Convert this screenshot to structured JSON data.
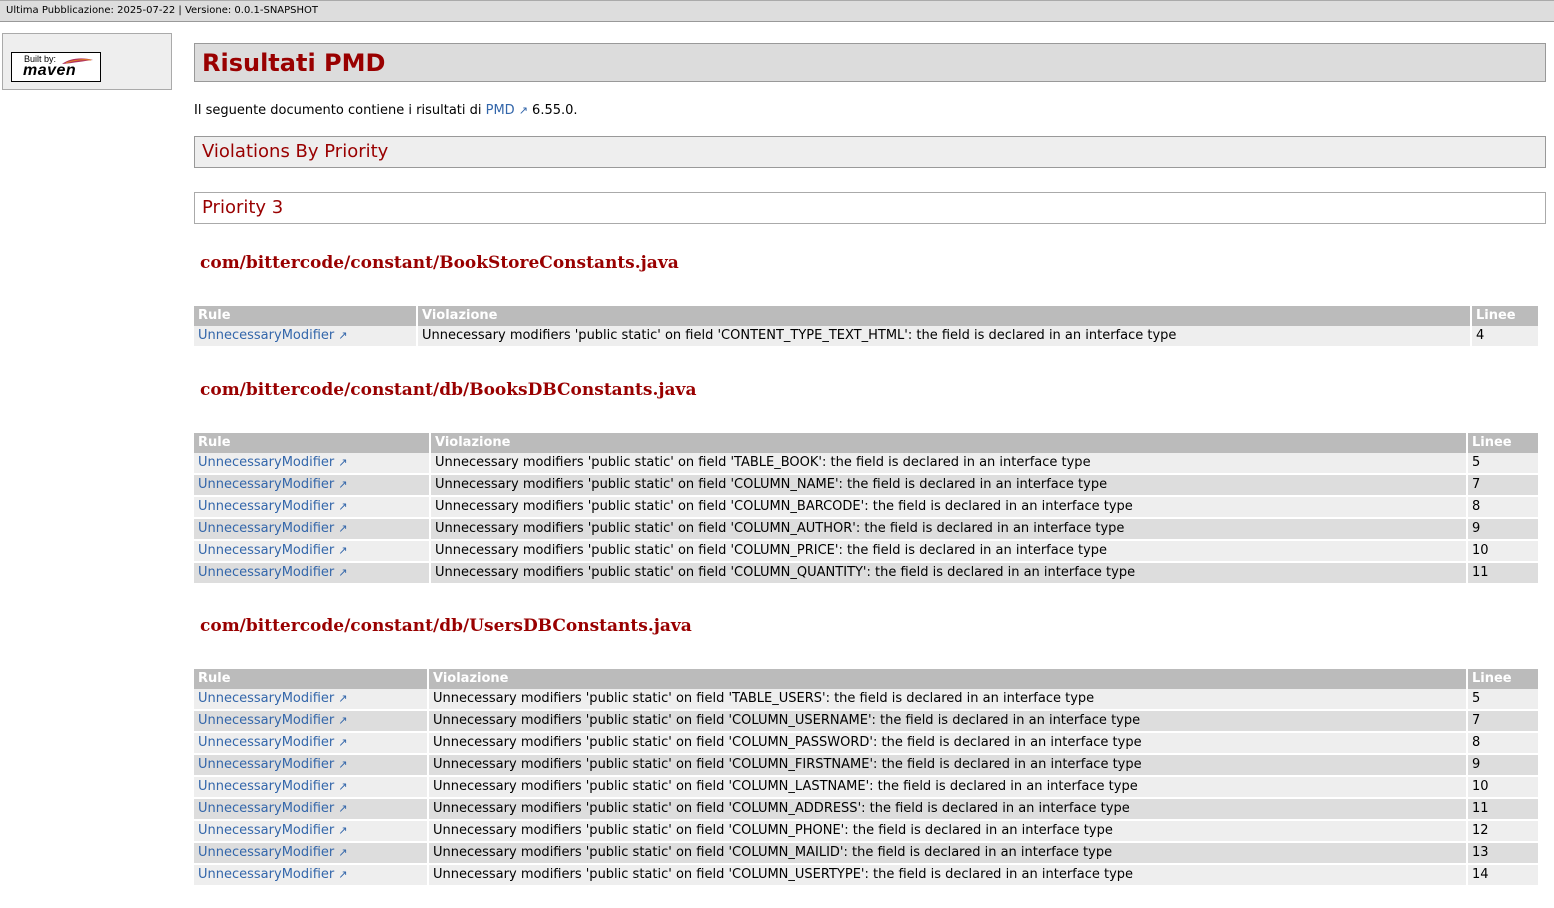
{
  "topbar": {
    "text": "Ultima Pubblicazione: 2025-07-22 | Versione: 0.0.1-SNAPSHOT"
  },
  "badge": {
    "built_by": "Built by:",
    "brand": "maven"
  },
  "page_title": "Risultati PMD",
  "intro": {
    "before": "Il seguente documento contiene i risultati di ",
    "link": "PMD",
    "after": " 6.55.0."
  },
  "section_title": "Violations By Priority",
  "priority_title": "Priority 3",
  "table_headers": {
    "rule": "Rule",
    "violation": "Violazione",
    "lines": "Linee"
  },
  "files": [
    {
      "name": "com/bittercode/constant/BookStoreConstants.java",
      "rows": [
        {
          "rule": "UnnecessaryModifier",
          "violation": "Unnecessary modifiers 'public static' on field 'CONTENT_TYPE_TEXT_HTML': the field is declared in an interface type",
          "line": "4"
        }
      ]
    },
    {
      "name": "com/bittercode/constant/db/BooksDBConstants.java",
      "rows": [
        {
          "rule": "UnnecessaryModifier",
          "violation": "Unnecessary modifiers 'public static' on field 'TABLE_BOOK': the field is declared in an interface type",
          "line": "5"
        },
        {
          "rule": "UnnecessaryModifier",
          "violation": "Unnecessary modifiers 'public static' on field 'COLUMN_NAME': the field is declared in an interface type",
          "line": "7"
        },
        {
          "rule": "UnnecessaryModifier",
          "violation": "Unnecessary modifiers 'public static' on field 'COLUMN_BARCODE': the field is declared in an interface type",
          "line": "8"
        },
        {
          "rule": "UnnecessaryModifier",
          "violation": "Unnecessary modifiers 'public static' on field 'COLUMN_AUTHOR': the field is declared in an interface type",
          "line": "9"
        },
        {
          "rule": "UnnecessaryModifier",
          "violation": "Unnecessary modifiers 'public static' on field 'COLUMN_PRICE': the field is declared in an interface type",
          "line": "10"
        },
        {
          "rule": "UnnecessaryModifier",
          "violation": "Unnecessary modifiers 'public static' on field 'COLUMN_QUANTITY': the field is declared in an interface type",
          "line": "11"
        }
      ]
    },
    {
      "name": "com/bittercode/constant/db/UsersDBConstants.java",
      "rows": [
        {
          "rule": "UnnecessaryModifier",
          "violation": "Unnecessary modifiers 'public static' on field 'TABLE_USERS': the field is declared in an interface type",
          "line": "5"
        },
        {
          "rule": "UnnecessaryModifier",
          "violation": "Unnecessary modifiers 'public static' on field 'COLUMN_USERNAME': the field is declared in an interface type",
          "line": "7"
        },
        {
          "rule": "UnnecessaryModifier",
          "violation": "Unnecessary modifiers 'public static' on field 'COLUMN_PASSWORD': the field is declared in an interface type",
          "line": "8"
        },
        {
          "rule": "UnnecessaryModifier",
          "violation": "Unnecessary modifiers 'public static' on field 'COLUMN_FIRSTNAME': the field is declared in an interface type",
          "line": "9"
        },
        {
          "rule": "UnnecessaryModifier",
          "violation": "Unnecessary modifiers 'public static' on field 'COLUMN_LASTNAME': the field is declared in an interface type",
          "line": "10"
        },
        {
          "rule": "UnnecessaryModifier",
          "violation": "Unnecessary modifiers 'public static' on field 'COLUMN_ADDRESS': the field is declared in an interface type",
          "line": "11"
        },
        {
          "rule": "UnnecessaryModifier",
          "violation": "Unnecessary modifiers 'public static' on field 'COLUMN_PHONE': the field is declared in an interface type",
          "line": "12"
        },
        {
          "rule": "UnnecessaryModifier",
          "violation": "Unnecessary modifiers 'public static' on field 'COLUMN_MAILID': the field is declared in an interface type",
          "line": "13"
        },
        {
          "rule": "UnnecessaryModifier",
          "violation": "Unnecessary modifiers 'public static' on field 'COLUMN_USERTYPE': the field is declared in an interface type",
          "line": "14"
        }
      ]
    }
  ],
  "icons": {
    "external_link": "external-link-icon"
  },
  "colors": {
    "heading": "#990000",
    "link": "#3366aa",
    "header_bg": "#bbbbbb"
  }
}
